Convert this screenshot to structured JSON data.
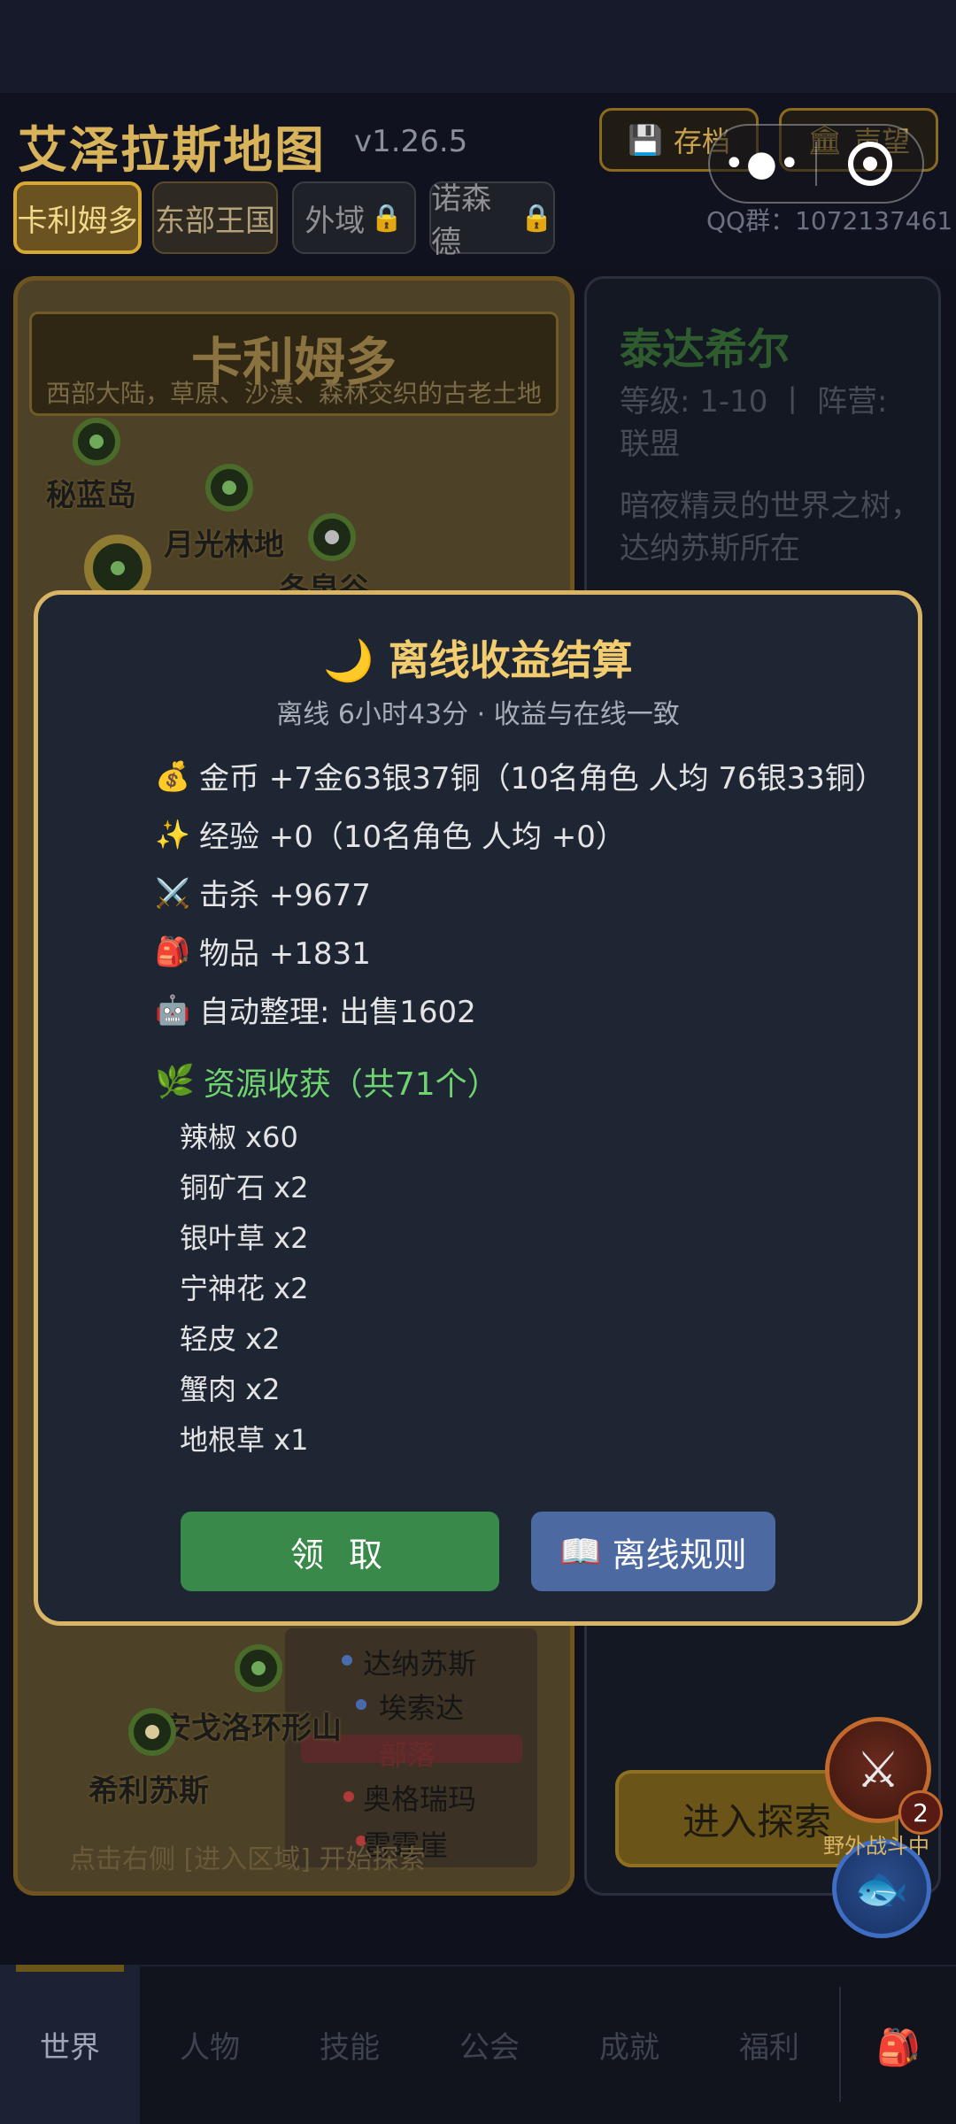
{
  "header": {
    "title": "艾泽拉斯地图",
    "version": "v1.26.5",
    "save_label": "存档",
    "honor_label": "声望",
    "qq_group": "QQ群：1072137461"
  },
  "tabs": [
    {
      "label": "卡利姆多",
      "locked": false,
      "active": true
    },
    {
      "label": "东部王国",
      "locked": false,
      "active": false
    },
    {
      "label": "外域",
      "locked": true,
      "active": false
    },
    {
      "label": "诺森德",
      "locked": true,
      "active": false
    }
  ],
  "map": {
    "name": "卡利姆多",
    "description": "西部大陆，草原、沙漠、森林交织的古老土地",
    "locations": [
      "秘蓝岛",
      "月光林地",
      "冬泉谷",
      "安戈洛环形山",
      "希利苏斯"
    ],
    "cities": [
      "达纳苏斯",
      "埃索达",
      "部落",
      "奥格瑞玛",
      "雷霆崖"
    ],
    "hint": "点击右侧 [进入区域] 开始探索"
  },
  "region": {
    "name": "泰达希尔",
    "level_faction": "等级: 1-10 丨 阵营: 联盟",
    "description": "暗夜精灵的世界之树，达纳苏斯所在"
  },
  "modal": {
    "title": "离线收益结算",
    "subtitle": "离线 6小时43分 · 收益与在线一致",
    "stats": [
      {
        "icon": "money-bag-icon",
        "glyph": "💰",
        "text": "金币 +7金63银37铜（10名角色 人均 76银33铜）"
      },
      {
        "icon": "sparkles-icon",
        "glyph": "✨",
        "text": "经验 +0（10名角色 人均 +0）"
      },
      {
        "icon": "crossed-swords-icon",
        "glyph": "⚔️",
        "text": "击杀 +9677"
      },
      {
        "icon": "backpack-icon",
        "glyph": "🎒",
        "text": "物品 +1831"
      },
      {
        "icon": "robot-icon",
        "glyph": "🤖",
        "text": "自动整理: 出售1602"
      }
    ],
    "resources_header": "资源收获（共71个）",
    "resources": [
      "辣椒 x60",
      "铜矿石 x2",
      "银叶草 x2",
      "宁神花 x2",
      "轻皮 x2",
      "蟹肉 x2",
      "地根草 x1"
    ],
    "claim_label": "领 取",
    "rules_label": "离线规则"
  },
  "explore_label": "进入探索",
  "battle": {
    "badge": "2",
    "label": "野外战斗中"
  },
  "nav": [
    "世界",
    "人物",
    "技能",
    "公会",
    "成就",
    "福利"
  ],
  "colors": {
    "gold": "#d9b465",
    "green": "#39894a",
    "blue": "#4c69a1",
    "modal_bg": "#1e2533"
  }
}
